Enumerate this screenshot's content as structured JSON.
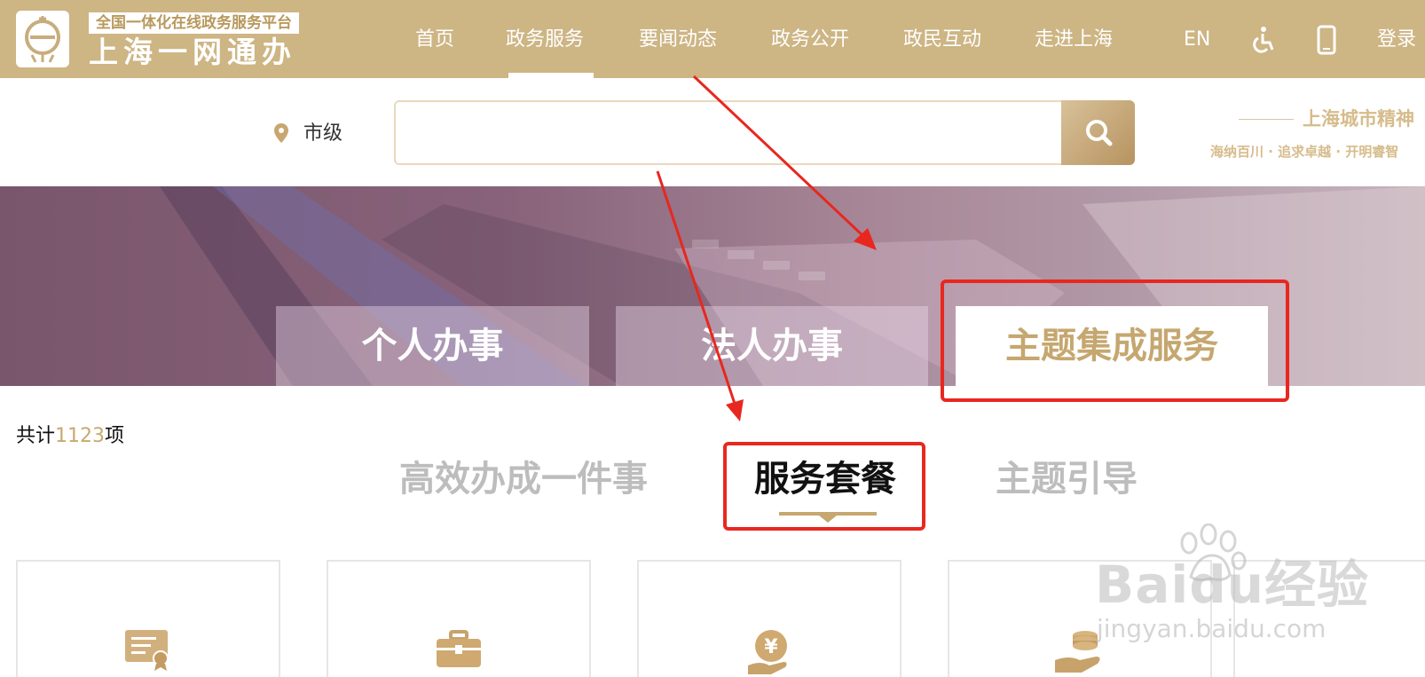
{
  "header": {
    "brand_subtitle": "全国一体化在线政务服务平台",
    "brand_title": "上海一网通办",
    "nav": [
      "首页",
      "政务服务",
      "要闻动态",
      "政务公开",
      "政民互动",
      "走进上海"
    ],
    "active_nav": "政务服务",
    "lang_label": "EN",
    "accessibility_icon": "wheelchair-icon",
    "mobile_icon": "mobile-phone-icon",
    "login_label": "登录"
  },
  "search": {
    "location_label": "市级",
    "location_icon": "location-pin-icon",
    "query": "",
    "button_icon": "search-icon"
  },
  "slogan": {
    "main": "上海城市精神",
    "sub": "海纳百川 · 追求卓越 · 开明睿智"
  },
  "main_tabs": {
    "personal": "个人办事",
    "legal": "法人办事",
    "theme": "主题集成服务",
    "active": "主题集成服务"
  },
  "count": {
    "prefix": "共计",
    "number": "1123",
    "suffix": "项"
  },
  "sub_tabs": {
    "efficient": "高效办成一件事",
    "package": "服务套餐",
    "guide": "主题引导",
    "active": "服务套餐"
  },
  "cards": [
    {
      "icon": "certificate-icon"
    },
    {
      "icon": "briefcase-icon"
    },
    {
      "icon": "yuan-coin-hand-icon"
    },
    {
      "icon": "coins-hand-icon"
    },
    {
      "icon": "document-icon"
    }
  ],
  "watermark": {
    "brand": "Baidu经验",
    "url": "jingyan.baidu.com"
  },
  "colors": {
    "header_bg": "#cdb584",
    "accent_gold": "#c5a76f",
    "annotation_red": "#e8271f"
  }
}
